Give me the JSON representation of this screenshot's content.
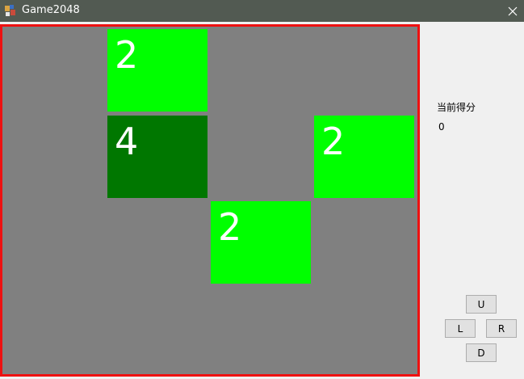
{
  "window": {
    "title": "Game2048",
    "titlebar_color": "#525a52",
    "border_color": "#ee1111"
  },
  "board": {
    "rows": 4,
    "cols": 4,
    "background": "#808080",
    "tiles": [
      {
        "row": 0,
        "col": 1,
        "value": "2",
        "color": "#00ff00"
      },
      {
        "row": 1,
        "col": 1,
        "value": "4",
        "color": "#007700"
      },
      {
        "row": 1,
        "col": 3,
        "value": "2",
        "color": "#00ff00"
      },
      {
        "row": 2,
        "col": 2,
        "value": "2",
        "color": "#00ff00"
      }
    ]
  },
  "score": {
    "label": "当前得分",
    "value": "0"
  },
  "controls": {
    "up": "U",
    "left": "L",
    "right": "R",
    "down": "D"
  }
}
